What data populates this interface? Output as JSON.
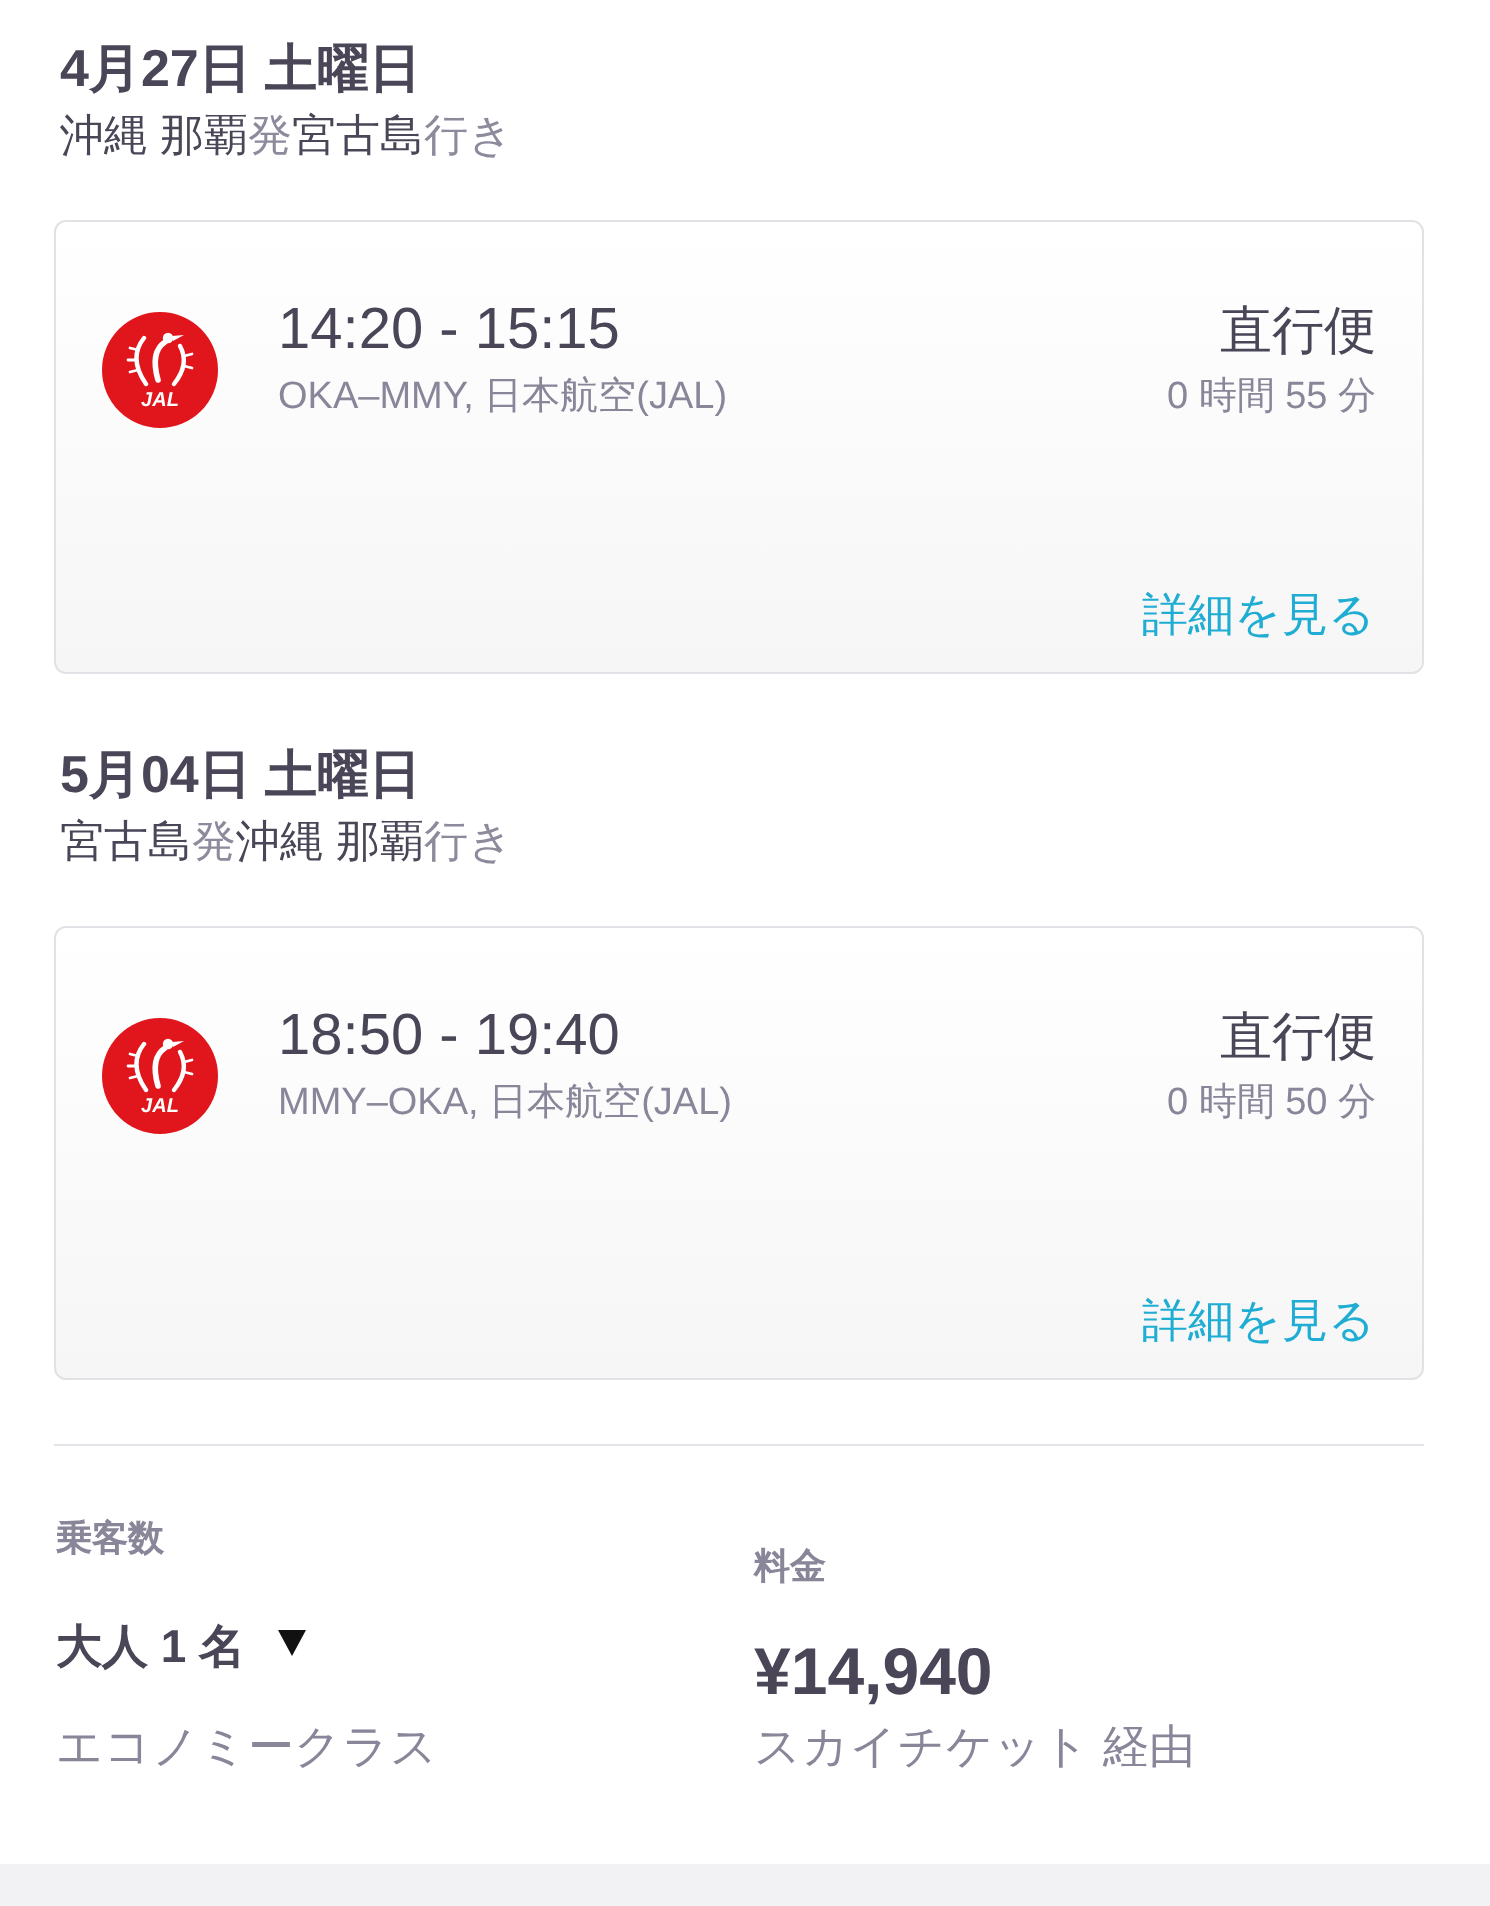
{
  "legs": [
    {
      "date": "4月27日 土曜日",
      "route": {
        "origin": "沖縄 那覇",
        "from_word": "発",
        "destination": "宮古島",
        "to_word": "行き"
      },
      "flight": {
        "logo_text": "JAL",
        "times": "14:20 - 15:15",
        "details": "OKA–MMY, 日本航空(JAL)",
        "stops": "直行便",
        "duration": "0 時間 55 分",
        "link": "詳細を見る"
      }
    },
    {
      "date": "5月04日 土曜日",
      "route": {
        "origin": "宮古島",
        "from_word": "発",
        "destination": "沖縄 那覇",
        "to_word": "行き"
      },
      "flight": {
        "logo_text": "JAL",
        "times": "18:50 - 19:40",
        "details": "MMY–OKA, 日本航空(JAL)",
        "stops": "直行便",
        "duration": "0 時間 50 分",
        "link": "詳細を見る"
      }
    }
  ],
  "passengers": {
    "label": "乗客数",
    "value": "大人 1 名",
    "cabin": "エコノミークラス"
  },
  "fare": {
    "label": "料金",
    "price": "¥14,940",
    "via": "スカイチケット 経由"
  }
}
